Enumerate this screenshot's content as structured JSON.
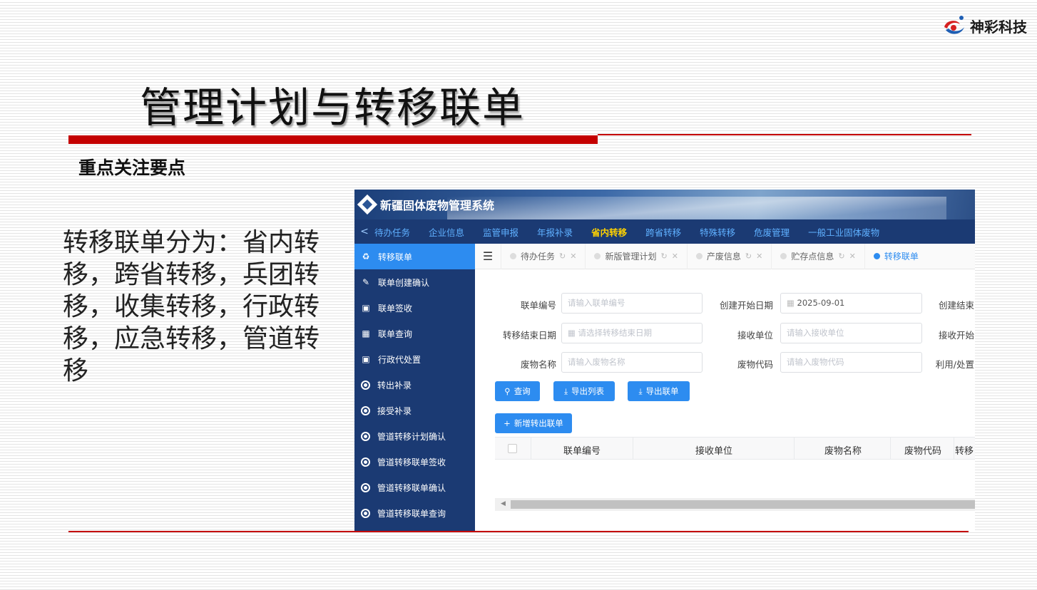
{
  "logo": {
    "text": "神彩科技"
  },
  "slide": {
    "title": "管理计划与转移联单",
    "subtitle": "重点关注要点",
    "body": "转移联单分为：省内转移，跨省转移，兵团转移，收集转移，行政转移，应急转移，管道转移"
  },
  "app": {
    "title": "新疆固体废物管理系统",
    "topnav": [
      "待办任务",
      "企业信息",
      "监管申报",
      "年报补录",
      "省内转移",
      "跨省转移",
      "特殊转移",
      "危废管理",
      "一般工业固体废物"
    ],
    "topnav_active": "省内转移",
    "sidebar": [
      {
        "label": "转移联单",
        "icon": "recycle-icon"
      },
      {
        "label": "联单创建确认",
        "icon": "edit-doc-icon"
      },
      {
        "label": "联单签收",
        "icon": "sign-icon"
      },
      {
        "label": "联单查询",
        "icon": "query-icon"
      },
      {
        "label": "行政代处置",
        "icon": "sign-icon"
      },
      {
        "label": "转出补录",
        "icon": "circle-dot-icon"
      },
      {
        "label": "接受补录",
        "icon": "circle-dot-icon"
      },
      {
        "label": "管道转移计划确认",
        "icon": "circle-dot-icon"
      },
      {
        "label": "管道转移联单签收",
        "icon": "circle-dot-icon"
      },
      {
        "label": "管道转移联单确认",
        "icon": "circle-dot-icon"
      },
      {
        "label": "管道转移联单查询",
        "icon": "circle-dot-icon"
      }
    ],
    "tabs": [
      "待办任务",
      "新版管理计划",
      "产废信息",
      "贮存点信息",
      "转移联单"
    ],
    "form": {
      "manifest_no_label": "联单编号",
      "manifest_no_placeholder": "请输入联单编号",
      "create_start_label": "创建开始日期",
      "create_start_value": "2025-09-01",
      "create_end_label": "创建结束",
      "transfer_end_label": "转移结束日期",
      "transfer_end_placeholder": "请选择转移结束日期",
      "receiver_label": "接收单位",
      "receiver_placeholder": "请输入接收单位",
      "receive_start_label": "接收开始",
      "waste_name_label": "废物名称",
      "waste_name_placeholder": "请输入废物名称",
      "waste_code_label": "废物代码",
      "waste_code_placeholder": "请输入废物代码",
      "usage_label": "利用/处置"
    },
    "buttons": {
      "query": "查询",
      "export_list": "导出列表",
      "export_manifest": "导出联单",
      "add_manifest": "新增转出联单"
    },
    "table_headers": [
      "联单编号",
      "接收单位",
      "废物名称",
      "废物代码",
      "转移"
    ]
  }
}
